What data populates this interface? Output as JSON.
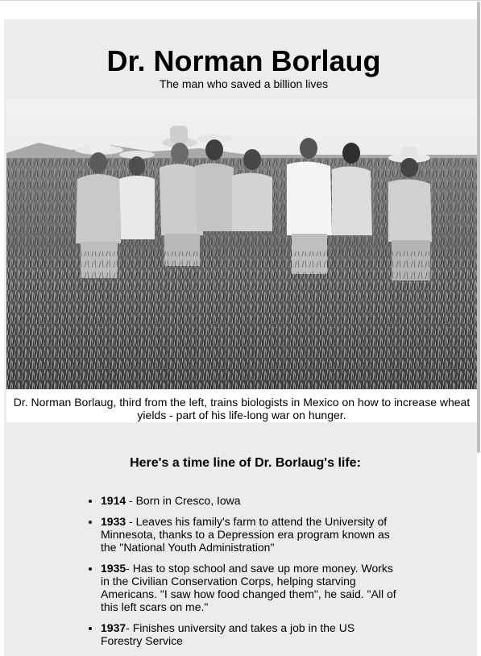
{
  "header": {
    "title": "Dr. Norman Borlaug",
    "subtitle": "The man who saved a billion lives"
  },
  "photo": {
    "caption": "Dr. Norman Borlaug, third from the left, trains biologists in Mexico on how to increase wheat yields - part of his life-long war on hunger."
  },
  "timeline": {
    "heading": "Here's a time line of Dr. Borlaug's life:",
    "items": [
      {
        "year": "1914",
        "text": " - Born in Cresco, Iowa"
      },
      {
        "year": "1933",
        "text": " - Leaves his family's farm to attend the University of Minnesota, thanks to a Depression era program known as the \"National Youth Administration\""
      },
      {
        "year": "1935",
        "text": "- Has to stop school and save up more money. Works in the Civilian Conservation Corps, helping starving Americans. \"I saw how food changed them\", he said. \"All of this left scars on me.\""
      },
      {
        "year": "1937",
        "text": "- Finishes university and takes a job in the US Forestry Service"
      }
    ]
  }
}
